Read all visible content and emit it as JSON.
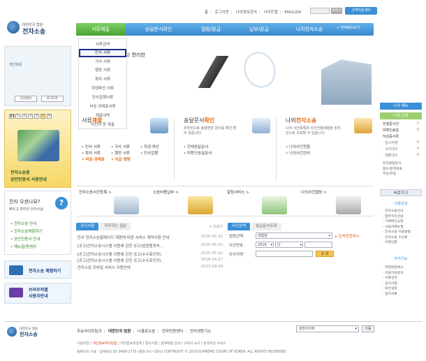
{
  "util_links": [
    "홈",
    "로그아웃",
    "나의정보관리",
    "사이트맵",
    "ENGLISH"
  ],
  "util_search_label": "통합검색",
  "help_label": "고객지원센터",
  "logo": {
    "small": "대한민국 법원",
    "big": "전자소송"
  },
  "gnb": [
    {
      "label": "서류제출",
      "active": true
    },
    {
      "label": "송달문서확인",
      "active": false
    },
    {
      "label": "열람/발급",
      "active": false
    },
    {
      "label": "납부/환급",
      "active": false
    },
    {
      "label": "나의전자소송",
      "active": false
    }
  ],
  "gnb_all": "+ 전체메뉴보기",
  "dropdown": [
    "서류검색",
    "민사 서류",
    "가사 서류",
    "행정 서류",
    "특허 서류",
    "회생파산 서류",
    "민사집행서류",
    "비송·과태료서류",
    "제출내역",
    "최신서 등 제출"
  ],
  "dropdown_selected": 1,
  "login": {
    "label": "개인회원",
    "btn_info": "나의정보",
    "btn_logout": "로그아웃"
  },
  "promo": {
    "pager": [
      "1",
      "2",
      "3",
      "4",
      "5",
      "6"
    ],
    "line1": "전자소송용",
    "line2": "공인인증서 사용안내"
  },
  "howto": {
    "title": "전자 오셨나요?",
    "sub": "빠르고 편리한 전자소송",
    "items": [
      "• 전자소송 안내",
      "• 전자소송체험하기",
      "• 공인인증서 안내",
      "• 매뉴얼/동영상"
    ]
  },
  "side_buttons": [
    "전자소송 체험하기",
    "브라우저별\n사용자안내"
  ],
  "visual_caption": "고 편리한",
  "services": [
    {
      "h1": "서류",
      "h2": "제출",
      "desc": "",
      "links": [
        [
          "• 민사 서류",
          "• 가사 서류",
          "• 회생·파산"
        ],
        [
          "• 특허 서류",
          "• 행정 서류",
          "• 민사집행"
        ],
        [
          "• 비송·과태료",
          "• 지급 명령",
          ""
        ]
      ]
    },
    {
      "h1": "송달문서",
      "h2": "확인",
      "desc": "온라인으로 송달받은 문서를 확인 할 수 있습니다.",
      "links": [
        [
          "• 전체송달문서"
        ],
        [
          "• 미확인송달문서"
        ]
      ]
    },
    {
      "h1": "나의",
      "h2": "전자소송",
      "desc": "나의 사건목록과 사건진행내용을 온라인으로 조회할 수 있습니다.",
      "links": [
        [
          "• 나의사건현황"
        ],
        [
          "• 나의사건관리"
        ]
      ]
    }
  ],
  "banners": [
    "전자소송사건등록 >",
    "소송비용납부 >",
    "알림서비스 >",
    "나의사건열람 >"
  ],
  "notice": {
    "tab_on": "공지사항",
    "tab_off": "자주하는 질문",
    "more": "+ 더보기",
    "rows": [
      {
        "text": "·민사 전자소송홈페이지 개편에 따른 서비스 제약사항 안내",
        "date": "2016.05.31"
      },
      {
        "text": "·[공고]전자소송시스템 이용에 관한 공고(법원행정처...",
        "date": "2016.05.02"
      },
      {
        "text": "·[공고]전자소송시스템 이용에 관한 공고(수수료인하)",
        "date": "2016.05.02"
      },
      {
        "text": "·[공고]전자소송시스템 이용에 관한 공고(수수료인하)",
        "date": "2016.04.27"
      },
      {
        "text": "·전자소송 모바일 서비스 이용안내",
        "date": "2013.09.09"
      }
    ]
  },
  "search": {
    "tab_on": "사건검색",
    "tab_off": "발급문서조회",
    "court_label": "법원선택",
    "court_value": "대법원",
    "help": "▸ 입력방법예시",
    "case_label": "사건번호",
    "year": "2016",
    "type": "다",
    "party_label": "당사자명",
    "go": "조 회"
  },
  "right": {
    "menu_head": "나의 메뉴",
    "lawsuit_head": "나의 소송",
    "stats": [
      {
        "label": "진행중사건",
        "num": "2"
      },
      {
        "label": "미확인송달",
        "num": "0"
      },
      {
        "label": "작성중서류",
        "num": ""
      },
      {
        "label": "· 임시저장",
        "num": "0"
      },
      {
        "label": "· 고지대기",
        "num": "0"
      },
      {
        "label": "· 제출대기",
        "num": "0"
      }
    ],
    "sub_links": [
      "전자송달문서",
      "접수/운영목록",
      "부관/부정"
    ],
    "quick_head": "바로가기",
    "guide_head": "이용안내",
    "guide_links": [
      "· 전자소송안내",
      "· 업무처리안내",
      "· 기록확인요령",
      "· 사용자매뉴얼",
      "· 전자소송 이용방법",
      "· 전자소송 수수료",
      "· 서명인증"
    ],
    "more_head": "부가기능",
    "more_links": [
      "· 파일변환예시",
      "· 이용지원문서",
      "· 서류검색",
      "· 공지사항",
      "· 보안설정",
      "· 정지서류"
    ]
  },
  "footer": {
    "links": [
      "주요사이트링크",
      "대한민국 법원",
      "나홀로소송",
      "전자민원센터",
      "인터넷등기소"
    ],
    "select": "관련사이트",
    "go": "이동",
    "line1_prefix": "이용약관",
    "line1_red": "개인정보처리방침",
    "line1_rest": "저작권보호정책 | 협조사항 | 문제해결 안내 | 고객의 소리 | 원격지원 서비스",
    "line2": "홈페이지 이용 · 장애문의 02-3480-1715 (평일 9시~18시)   COPYRIGHT © 2010 SUPREME COURT OF KOREA. ALL RIGHTS RESERVED."
  },
  "colors": {
    "gnb": "#3b88cf",
    "gnb_active": "#47a22f",
    "highlight": "#e46b1a",
    "selection_border": "#1c2f8a"
  }
}
